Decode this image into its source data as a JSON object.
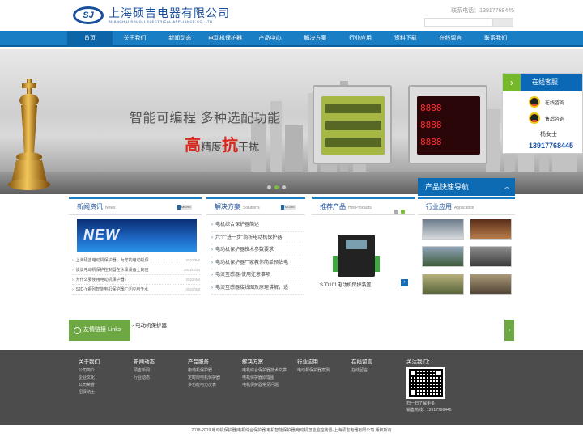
{
  "header": {
    "logo_mark": "SJ",
    "company_cn": "上海硕吉电器有限公司",
    "company_en": "SHANGHAI SHUOJI ELECTRICAL APPLIANCE CO.,LTD",
    "hotline": "联系电话：13917768445"
  },
  "nav": {
    "items": [
      "首页",
      "关于我们",
      "新闻动态",
      "电动机保护器",
      "产品中心",
      "解决方案",
      "行业应用",
      "资料下载",
      "在线留言",
      "联系我们"
    ]
  },
  "banner": {
    "slogan_line1": "智能可编程 多种选配功能",
    "slogan_high": "高",
    "slogan_mid": "精度",
    "slogan_anti": "抗",
    "slogan_tail": "干扰",
    "meter2_rows": [
      "8888",
      "8888",
      "8888"
    ]
  },
  "service": {
    "title": "在线客服",
    "presale": "在线咨询",
    "aftersale": "售后咨询",
    "contact_name": "杨女士",
    "contact_phone": "13917768445"
  },
  "quick_nav": {
    "title": "产品快速导航"
  },
  "news": {
    "title": "新闻资讯",
    "title_en": "News",
    "more": "MORE",
    "banner_word": "NEW",
    "items": [
      {
        "text": "上海硕吉电动机保护器，为您的电动机保",
        "date": "2022/5/2"
      },
      {
        "text": "谈谈电动机保护控制器在水泵设备上的应",
        "date": "2022/4/20"
      },
      {
        "text": "为什么要使用电动机保护器？",
        "date": "2022/4/6"
      },
      {
        "text": "SJD-Y系列智能电机保护器广泛应用于水",
        "date": "2022/3/8"
      }
    ]
  },
  "solutions": {
    "title": "解决方案",
    "title_en": "Solutions",
    "more": "MORE",
    "items": [
      "电机综合保护器简述",
      "六个\"进一步\"简析电动机保护器",
      "电动机保护器技术参数要求",
      "电动机保护器厂家教你简单预估电",
      "电流互感器-使用注意事项",
      "电流互感器接线图及原理讲解，适"
    ]
  },
  "products": {
    "title": "推荐产品",
    "title_en": "Hot Products",
    "caption": "SJD101电动机保护装置"
  },
  "apps": {
    "title": "行业应用",
    "title_en": "Application"
  },
  "links": {
    "label": "友情链接 Links",
    "items": [
      "电动机保护器"
    ]
  },
  "footer": {
    "columns": [
      {
        "title": "关于我们",
        "links": [
          "公司简介",
          "企业文化",
          "公司荣誉",
          "招贤纳士"
        ]
      },
      {
        "title": "新闻动态",
        "links": [
          "硕吉新闻",
          "行业动态"
        ]
      },
      {
        "title": "产品服务",
        "links": [
          "电动机保护器",
          "定时限电机保护器",
          "多功能电力仪表"
        ]
      },
      {
        "title": "解决方案",
        "links": [
          "电机综合保护器技术文章",
          "电机保护器原理图",
          "电机保护器常见问题"
        ]
      },
      {
        "title": "行业应用",
        "links": [
          "电动机保护器案例"
        ]
      },
      {
        "title": "在线留言",
        "links": [
          "在线留言"
        ]
      }
    ],
    "follow_title": "关注我们：",
    "qr_caption": "扫一扫了解更多",
    "sales_line": "销售热线：13917768445",
    "copyright": "2018-2019 电动机保护器|电机综合保护器|电机智能保护器|电动机智能监控装置-上海硕吉电器有限公司 版权所有"
  }
}
